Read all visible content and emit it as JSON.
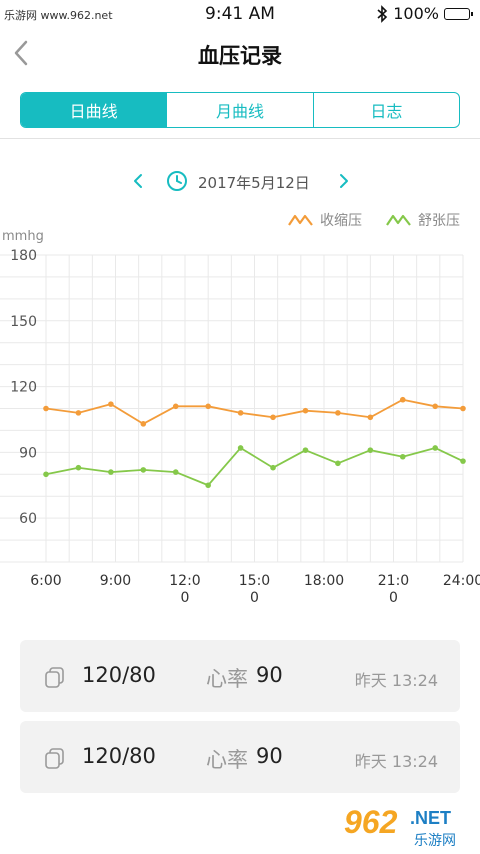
{
  "status_bar": {
    "watermark": "乐游网 www.962.net",
    "time": "9:41 AM",
    "battery": "100%"
  },
  "nav": {
    "title": "血压记录",
    "back_icon": "chevron-left-icon"
  },
  "tabs": [
    {
      "label": "日曲线",
      "active": true
    },
    {
      "label": "月曲线",
      "active": false
    },
    {
      "label": "日志",
      "active": false
    }
  ],
  "date_nav": {
    "date": "2017年5月12日",
    "prev_icon": "chevron-left-icon",
    "next_icon": "chevron-right-icon",
    "clock_icon": "clock-icon"
  },
  "colors": {
    "accent": "#17bcc1",
    "systolic": "#f39c3a",
    "diastolic": "#85c84a"
  },
  "chart_data": {
    "type": "line",
    "ylabel": "mmhg",
    "ylim": [
      40,
      180
    ],
    "yticks": [
      "180",
      "150",
      "120",
      "90",
      "60"
    ],
    "xlim": [
      6,
      24
    ],
    "x_ticks": [
      {
        "label": "6:00",
        "line2": "",
        "x": 6
      },
      {
        "label": "9:00",
        "line2": "",
        "x": 9
      },
      {
        "label": "12:0",
        "line2": "0",
        "x": 12
      },
      {
        "label": "15:0",
        "line2": "0",
        "x": 15
      },
      {
        "label": "18:00",
        "line2": "",
        "x": 18
      },
      {
        "label": "21:0",
        "line2": "0",
        "x": 21
      },
      {
        "label": "24:00",
        "line2": "",
        "x": 24
      }
    ],
    "x": [
      6,
      7.4,
      8.8,
      10.2,
      11.6,
      13,
      14.4,
      15.8,
      17.2,
      18.6,
      20,
      21.4,
      22.8,
      24
    ],
    "series": [
      {
        "name": "收缩压",
        "color": "#f39c3a",
        "values": [
          110,
          108,
          112,
          103,
          111,
          111,
          108,
          106,
          109,
          108,
          106,
          114,
          111,
          110
        ]
      },
      {
        "name": "舒张压",
        "color": "#85c84a",
        "values": [
          80,
          83,
          81,
          82,
          81,
          75,
          92,
          83,
          91,
          85,
          91,
          88,
          92,
          86
        ]
      }
    ],
    "grid": true,
    "legend": "top-right"
  },
  "records": [
    {
      "reading": "120/80",
      "hr_label": "心率",
      "hr_value": "90",
      "time": "昨天 13:24",
      "icon": "copy-icon"
    },
    {
      "reading": "120/80",
      "hr_label": "心率",
      "hr_value": "90",
      "time": "昨天 13:24",
      "icon": "copy-icon"
    }
  ],
  "branding": {
    "logo_text": "962",
    "net_text": ".NET",
    "sub_text": "乐游网"
  }
}
